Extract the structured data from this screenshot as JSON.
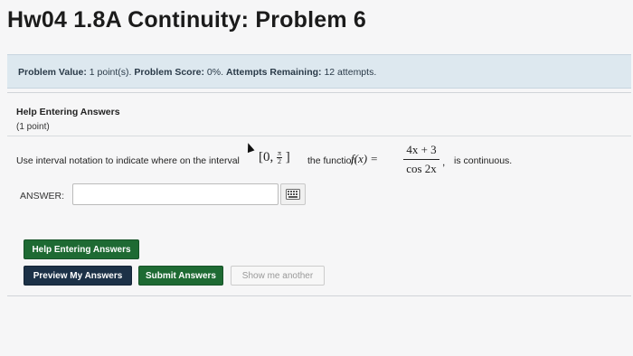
{
  "page": {
    "title": "Hw04 1.8A Continuity: Problem 6"
  },
  "info": {
    "value_label": "Problem Value:",
    "value_text": "1 point(s).",
    "score_label": "Problem Score:",
    "score_text": "0%.",
    "attempts_label": "Attempts Remaining:",
    "attempts_text": "12 attempts."
  },
  "help": {
    "heading": "Help Entering Answers",
    "points": "(1 point)"
  },
  "question": {
    "pre_text": "Use interval notation to indicate where on the interval",
    "interval_left": "[0,",
    "interval_frac_num": "π",
    "interval_frac_den": "2",
    "interval_right": "]",
    "mid_text": "the function",
    "fx": "f(x) =",
    "numerator": "4x + 3",
    "denominator": "cos 2x",
    "comma": ",",
    "post_text": "is continuous."
  },
  "answer": {
    "label": "ANSWER:",
    "value": "",
    "placeholder": ""
  },
  "buttons": {
    "help": "Help Entering Answers",
    "preview": "Preview My Answers",
    "submit": "Submit Answers",
    "another": "Show me another"
  },
  "colors": {
    "info_bar_bg": "#dde8ef",
    "green_button": "#1e6a33",
    "navy_button": "#1c3147"
  },
  "icons": {
    "keyboard": "keyboard-icon",
    "cursor": "mouse-cursor-icon"
  }
}
